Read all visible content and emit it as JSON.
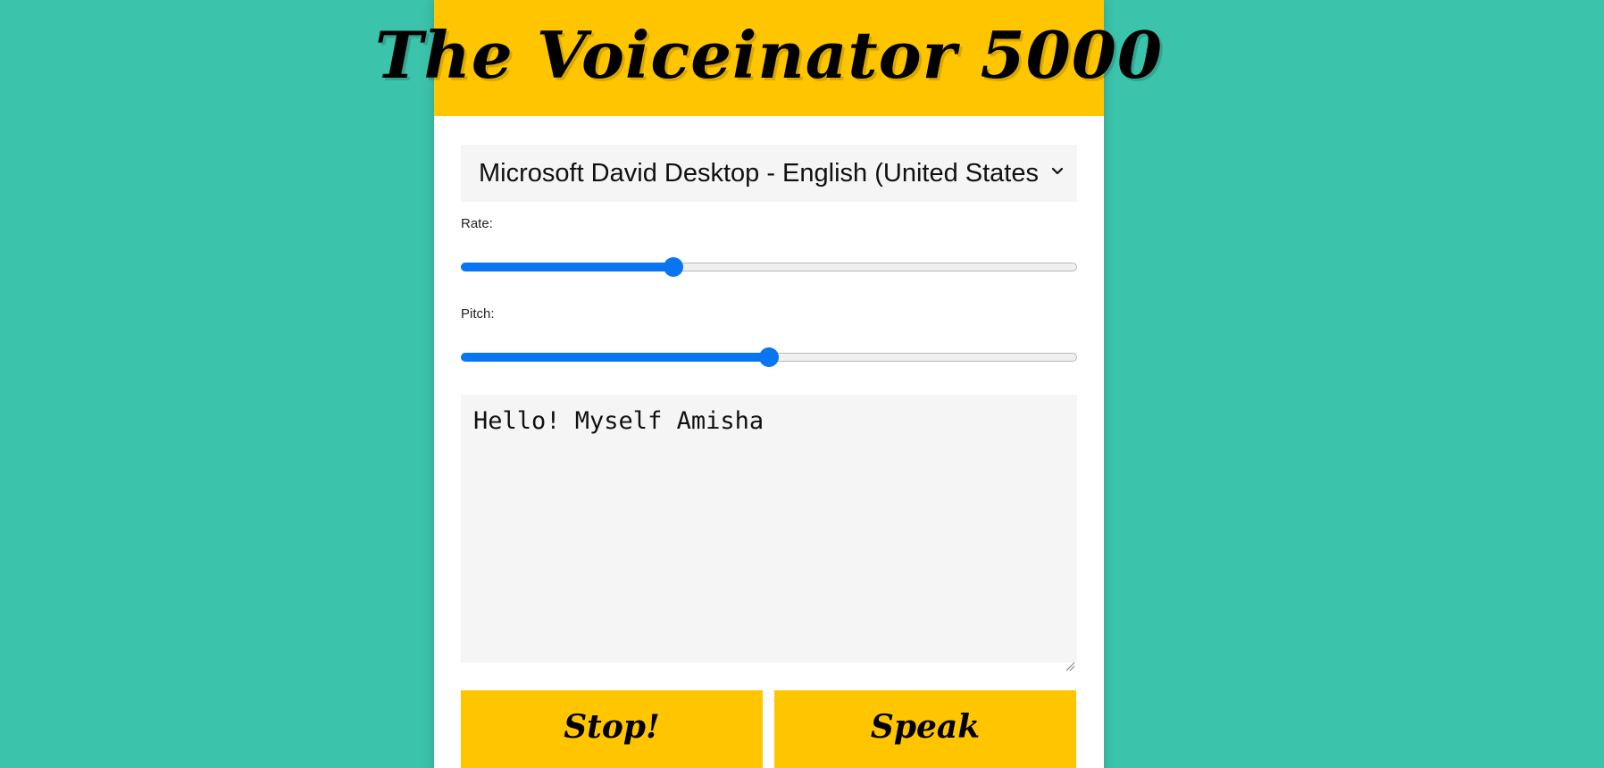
{
  "app": {
    "title": "The Voiceinator 5000"
  },
  "voice_select": {
    "selected": "Microsoft David Desktop - English (United States)"
  },
  "rate": {
    "label": "Rate:",
    "level": 0.345
  },
  "pitch": {
    "label": "Pitch:",
    "level": 0.5
  },
  "message": {
    "value": "Hello! Myself Amisha"
  },
  "buttons": {
    "stop_label": "Stop!",
    "speak_label": "Speak"
  },
  "colors": {
    "background": "#3cc3ab",
    "accent": "#ffc600",
    "slider": "#0a75f0"
  }
}
